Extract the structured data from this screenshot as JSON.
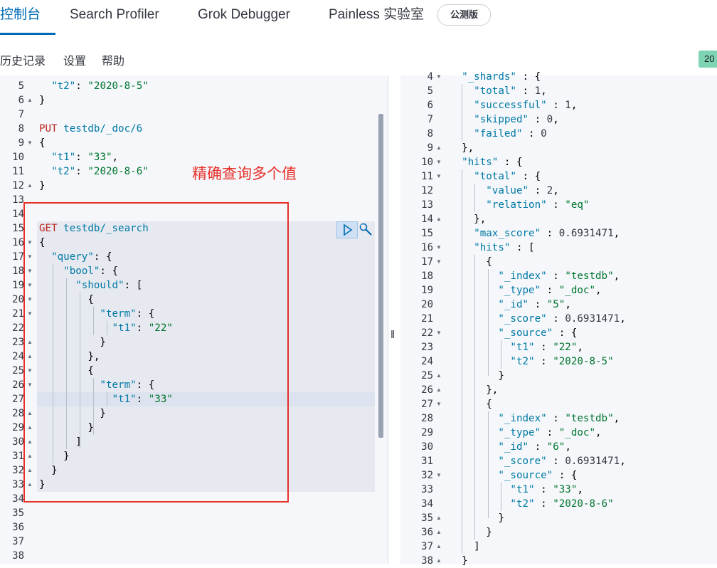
{
  "tabs": [
    {
      "label": "控制台",
      "active": true
    },
    {
      "label": "Search Profiler",
      "active": false
    },
    {
      "label": "Grok Debugger",
      "active": false
    },
    {
      "label": "Painless 实验室",
      "active": false
    }
  ],
  "beta_badge": "公测版",
  "toolbar": {
    "history": "历史记录",
    "settings": "设置",
    "help": "帮助",
    "status": "20"
  },
  "annotation": "精确查询多个值",
  "editor": {
    "line_numbers": [
      "5",
      "6",
      "7",
      "8",
      "9",
      "10",
      "11",
      "12",
      "13",
      "14",
      "15",
      "16",
      "17",
      "18",
      "19",
      "20",
      "21",
      "22",
      "23",
      "24",
      "25",
      "26",
      "27",
      "28",
      "29",
      "30",
      "31",
      "32",
      "33",
      "34",
      "35",
      "36",
      "37",
      "38"
    ],
    "lines": [
      "  \"t2\": \"2020-8-5\"",
      "}",
      "",
      "PUT testdb/_doc/6",
      "{",
      "  \"t1\": \"33\",",
      "  \"t2\": \"2020-8-6\"",
      "}",
      "",
      "",
      "GET testdb/_search",
      "{",
      "  \"query\": {",
      "    \"bool\": {",
      "      \"should\": [",
      "        {",
      "          \"term\": {",
      "            \"t1\": \"22\"",
      "          }",
      "        },",
      "        {",
      "          \"term\": {",
      "            \"t1\": \"33\"",
      "          }",
      "        }",
      "      ]",
      "    }",
      "  }",
      "}",
      "",
      "",
      "",
      "",
      ""
    ]
  },
  "output": {
    "line_numbers": [
      "4",
      "5",
      "6",
      "7",
      "8",
      "9",
      "10",
      "11",
      "12",
      "13",
      "14",
      "15",
      "16",
      "17",
      "18",
      "19",
      "20",
      "21",
      "22",
      "23",
      "24",
      "25",
      "26",
      "27",
      "28",
      "29",
      "30",
      "31",
      "32",
      "33",
      "34",
      "35",
      "36",
      "37",
      "38"
    ],
    "lines": [
      "  \"_shards\" : {",
      "    \"total\" : 1,",
      "    \"successful\" : 1,",
      "    \"skipped\" : 0,",
      "    \"failed\" : 0",
      "  },",
      "  \"hits\" : {",
      "    \"total\" : {",
      "      \"value\" : 2,",
      "      \"relation\" : \"eq\"",
      "    },",
      "    \"max_score\" : 0.6931471,",
      "    \"hits\" : [",
      "      {",
      "        \"_index\" : \"testdb\",",
      "        \"_type\" : \"_doc\",",
      "        \"_id\" : \"5\",",
      "        \"_score\" : 0.6931471,",
      "        \"_source\" : {",
      "          \"t1\" : \"22\",",
      "          \"t2\" : \"2020-8-5\"",
      "        }",
      "      },",
      "      {",
      "        \"_index\" : \"testdb\",",
      "        \"_type\" : \"_doc\",",
      "        \"_id\" : \"6\",",
      "        \"_score\" : 0.6931471,",
      "        \"_source\" : {",
      "          \"t1\" : \"33\",",
      "          \"t2\" : \"2020-8-6\"",
      "        }",
      "      }",
      "    ]",
      "  }"
    ]
  },
  "colors": {
    "accent": "#006bb4",
    "keyword": "#0079a5",
    "string": "#00752f",
    "method": "#bd271e",
    "annotation": "#e7302a"
  }
}
